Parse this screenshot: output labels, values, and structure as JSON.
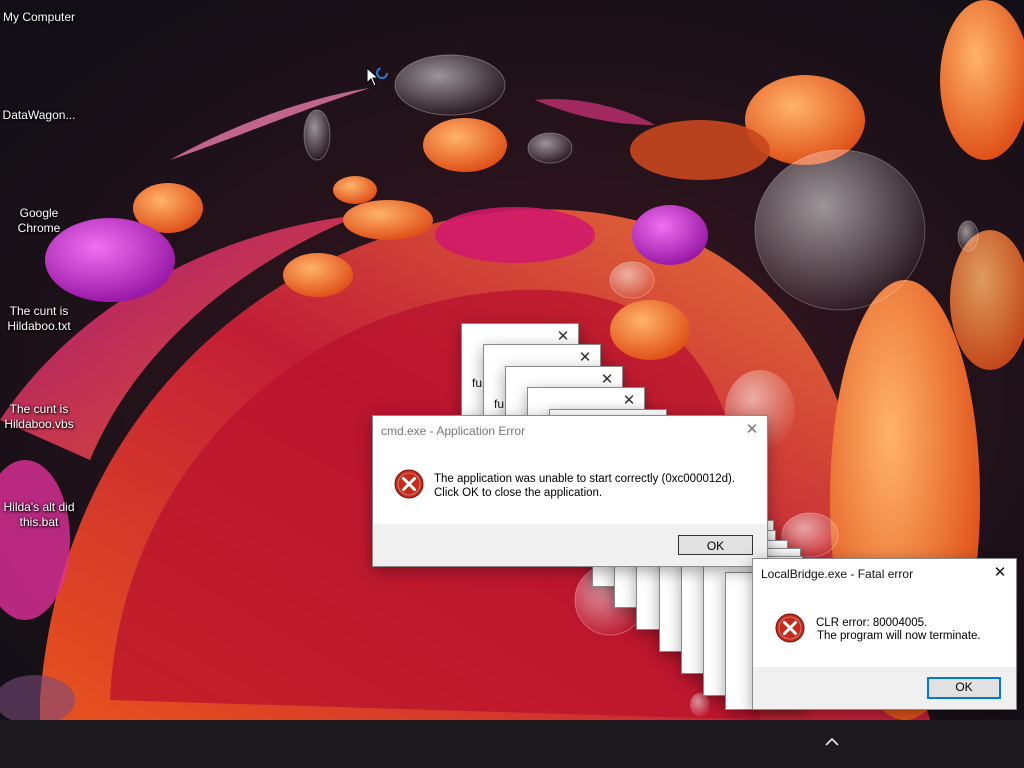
{
  "desktop": {
    "icons": [
      {
        "label": "My Computer"
      },
      {
        "label": "DataWagon..."
      },
      {
        "label": "Google Chrome",
        "lines": [
          "Google",
          "Chrome"
        ]
      },
      {
        "label": "The cunt is Hildaboo.txt",
        "lines": [
          "The cunt is",
          "Hildaboo.txt"
        ]
      },
      {
        "label": "The cunt is Hildaboo.vbs",
        "lines": [
          "The cunt is",
          "Hildaboo.vbs"
        ]
      },
      {
        "label": "Hilda's alt did this.bat",
        "lines": [
          "Hilda's alt did",
          "this.bat"
        ]
      }
    ]
  },
  "stacked_windows": {
    "text": "fu",
    "close_glyph": "✕"
  },
  "cmd_dialog": {
    "title": "cmd.exe - Application Error",
    "message_line1": "The application was unable to start correctly (0xc000012d).",
    "message_line2": "Click OK to close the application.",
    "ok_label": "OK",
    "close_glyph": "✕"
  },
  "localbridge_dialog": {
    "title": "LocalBridge.exe - Fatal error",
    "message_line1": "CLR error: 80004005.",
    "message_line2": " The program will now terminate.",
    "ok_label": "OK",
    "close_glyph": "✕"
  },
  "taskbar": {
    "tray_icon": "chevron-up-icon"
  },
  "colors": {
    "error_red": "#c42b1c",
    "focus_blue": "#0078d7",
    "taskbar": "#1c1a1f"
  }
}
